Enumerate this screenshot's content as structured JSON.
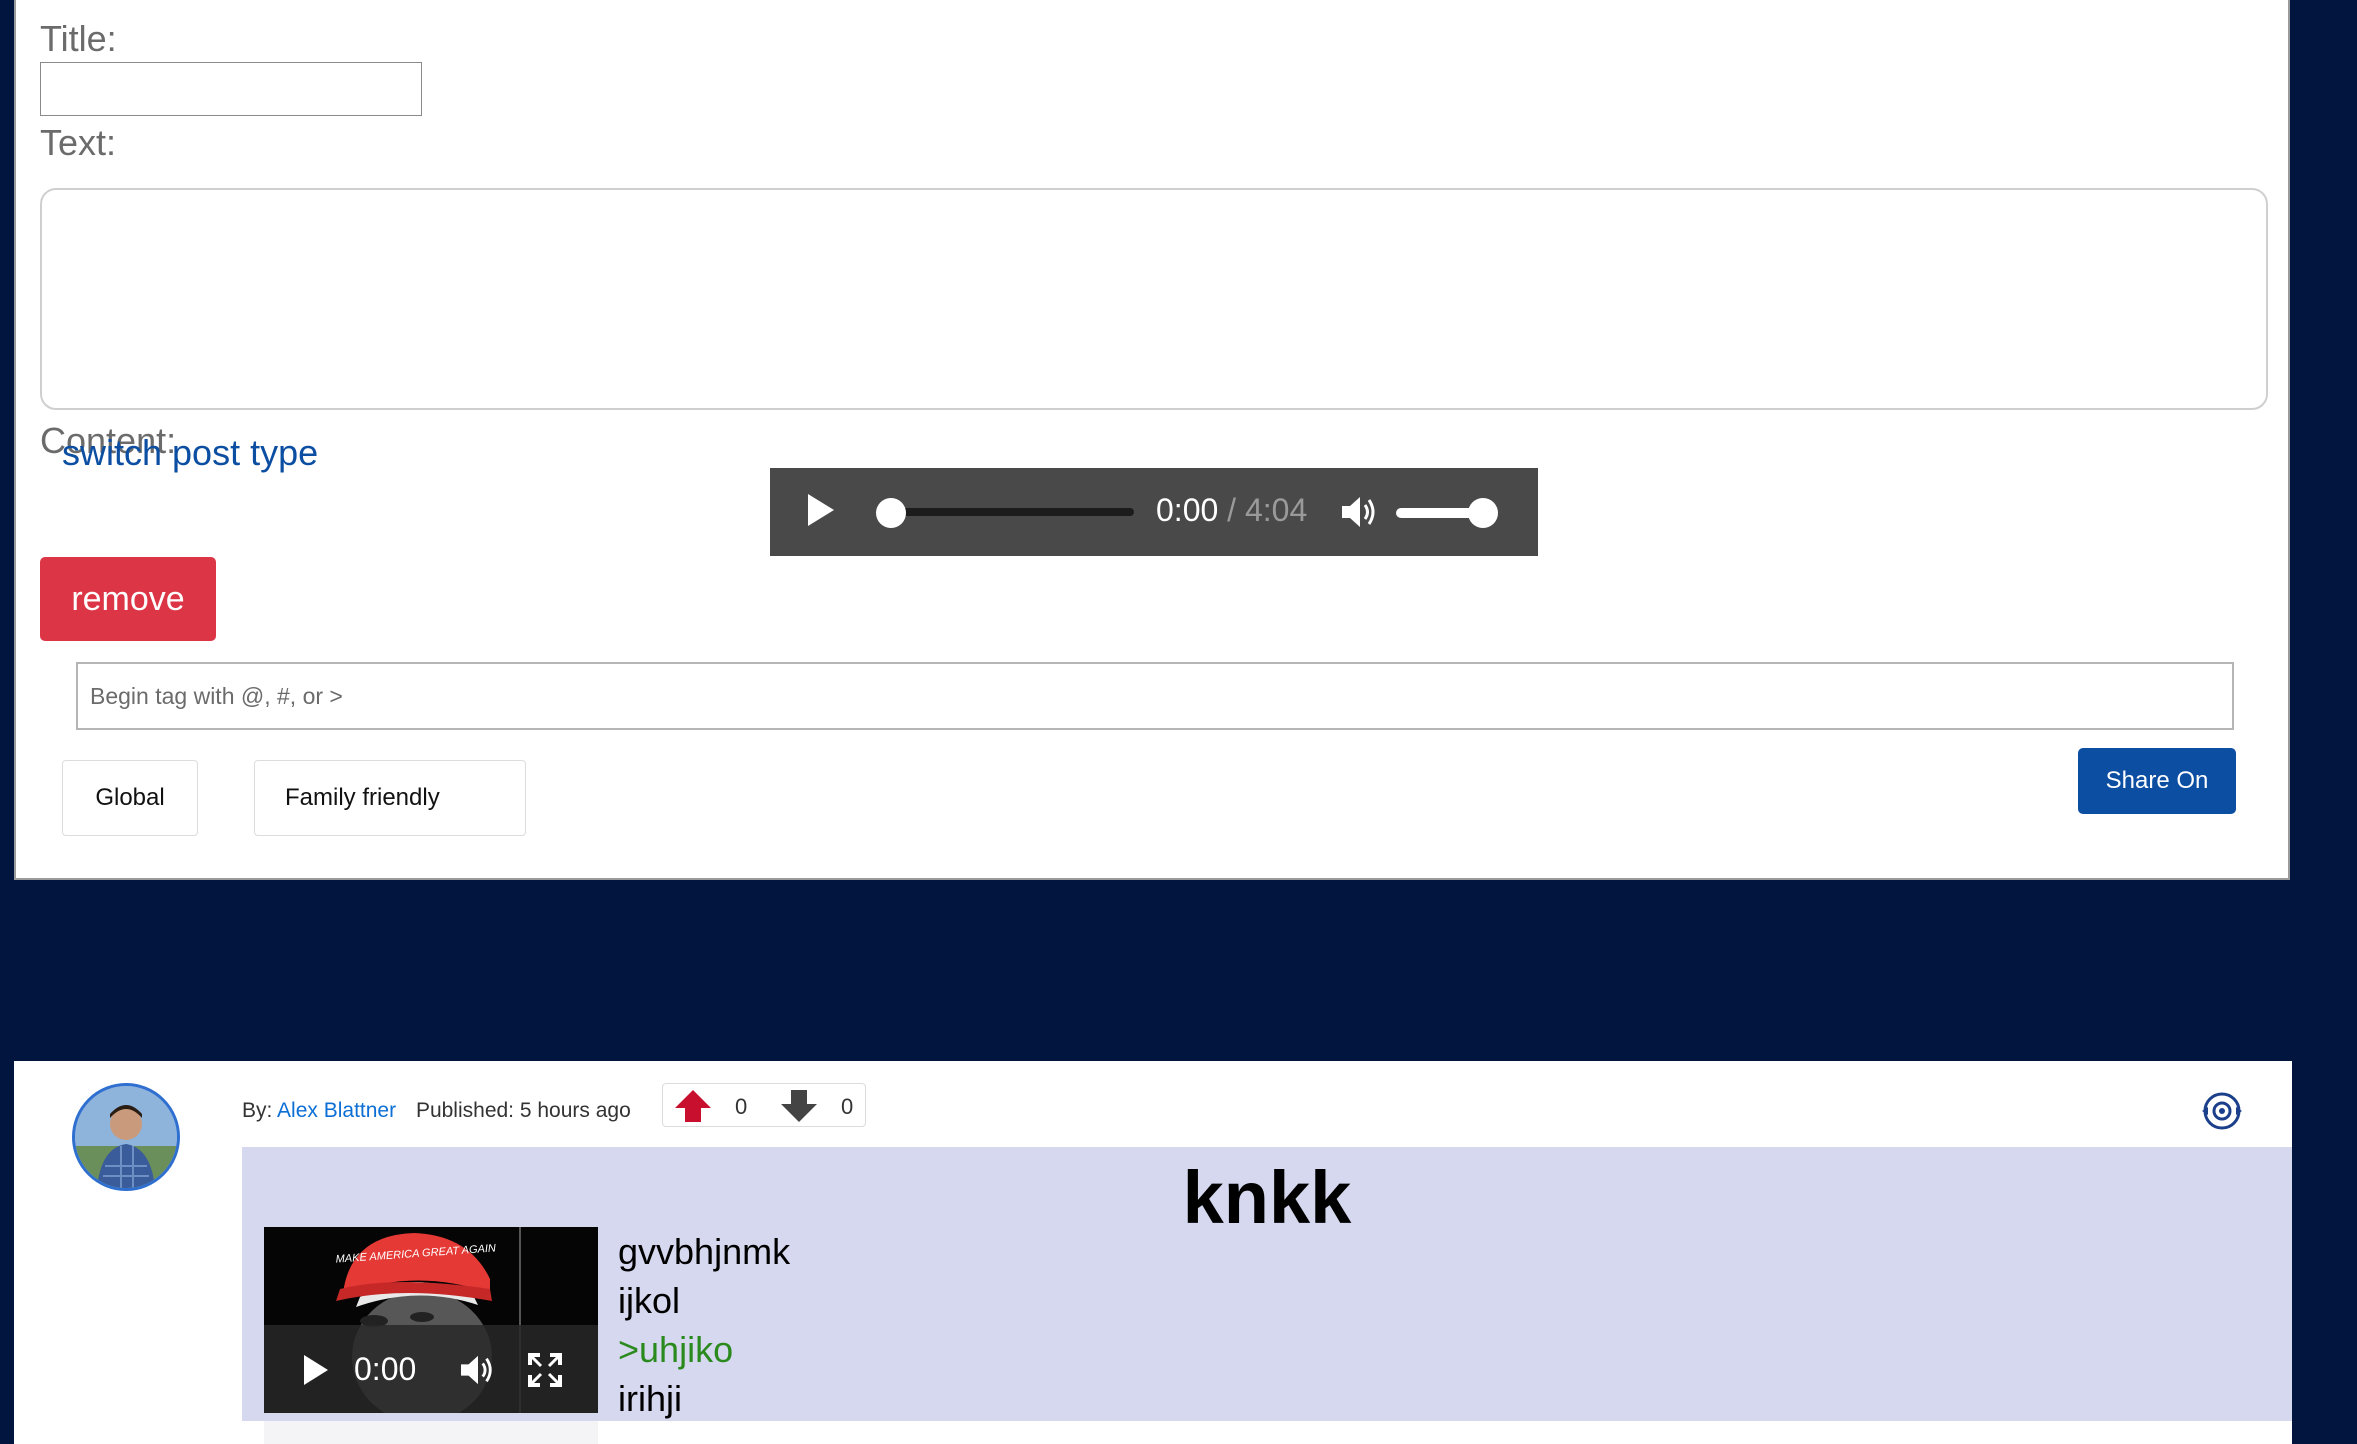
{
  "compose": {
    "title_label": "Title:",
    "text_label": "Text:",
    "content_label": "Content:",
    "switch_link": "switch post type",
    "audio": {
      "current": "0:00",
      "separator": "/",
      "duration": "4:04"
    },
    "remove_label": "remove",
    "tag_placeholder": "Begin tag with @, #, or >",
    "global_label": "Global",
    "family_label": "Family friendly",
    "share_label": "Share On"
  },
  "post": {
    "by_label": "By:",
    "author": "Alex Blattner",
    "published": "Published: 5 hours ago",
    "upvotes": "0",
    "downvotes": "0",
    "title": "knkk",
    "video_time": "0:00",
    "video_hat_text": "MAKE AMERICA GREAT AGAIN",
    "lines": [
      "gvvbhjnmk",
      "ijkol",
      ">uhjiko",
      "irihji"
    ]
  },
  "colors": {
    "page_bg": "#01153e",
    "primary": "#0b4ea2",
    "danger": "#dc3545",
    "upvote": "#c8102e",
    "greentext": "#2b8a1e",
    "post_bg": "#d5d8ee"
  },
  "icons": [
    "play-icon",
    "volume-icon",
    "fullscreen-icon",
    "upvote-arrow-icon",
    "downvote-arrow-icon",
    "settings-icon"
  ]
}
